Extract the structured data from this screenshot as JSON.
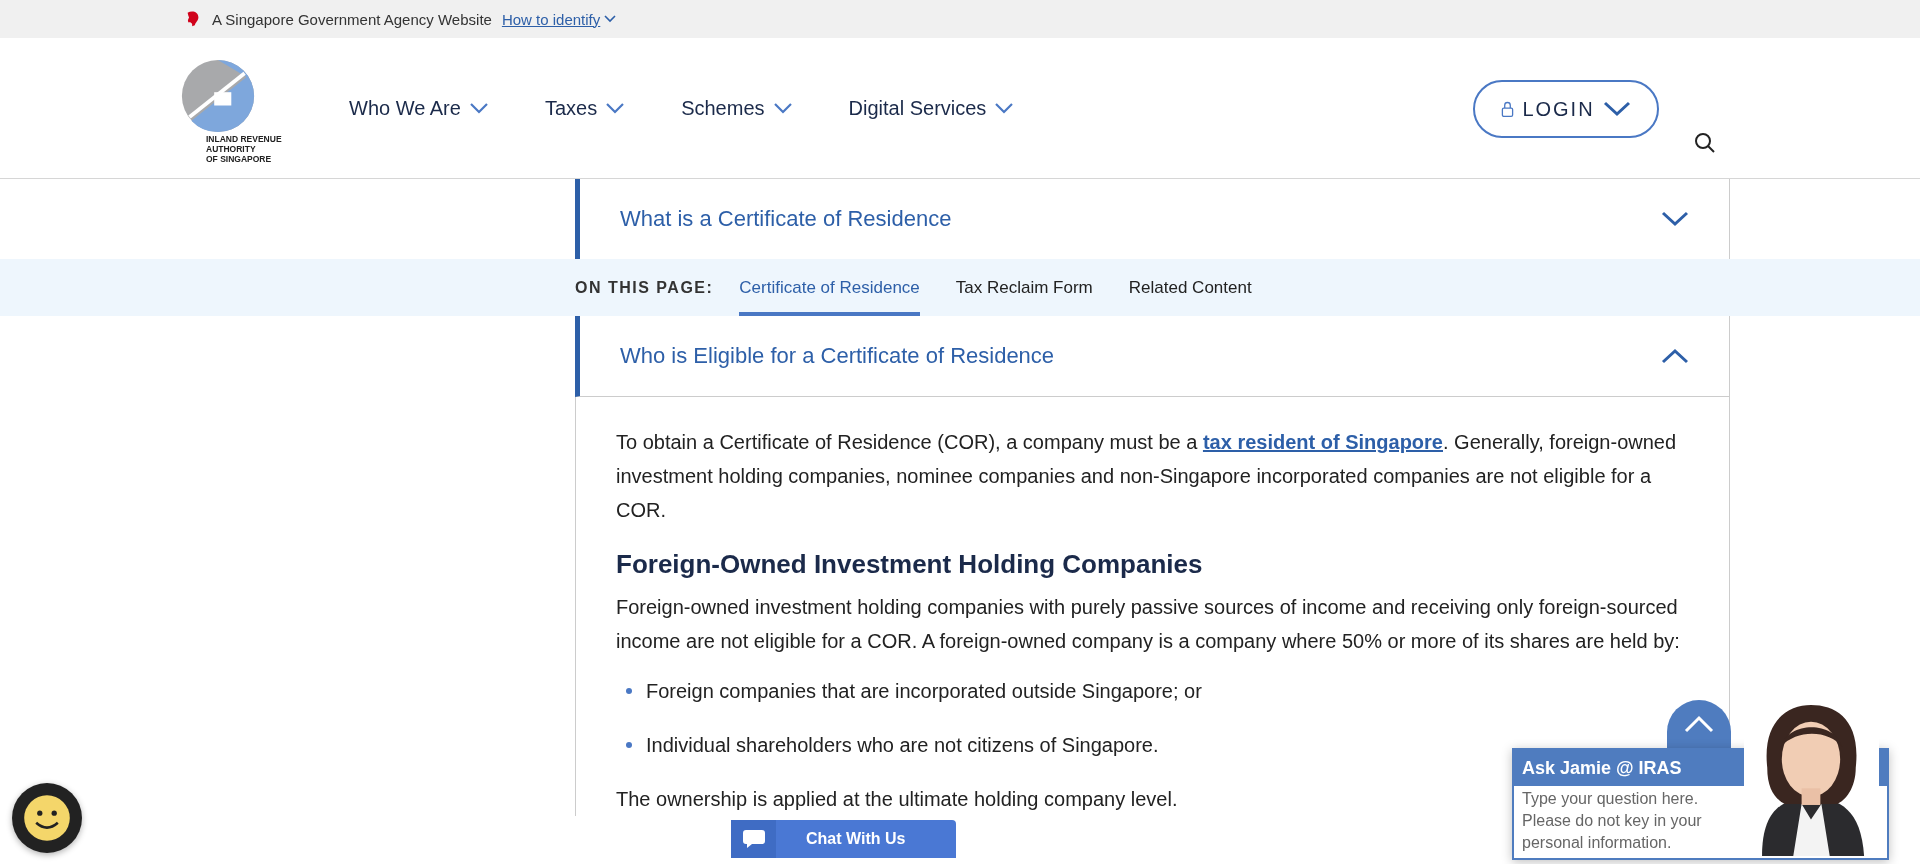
{
  "gov_banner": {
    "text": "A Singapore Government Agency Website",
    "link": "How to identify"
  },
  "logo": {
    "lines": [
      "INLAND REVENUE",
      "AUTHORITY",
      "OF SINGAPORE"
    ]
  },
  "nav": [
    {
      "label": "Who We Are"
    },
    {
      "label": "Taxes"
    },
    {
      "label": "Schemes"
    },
    {
      "label": "Digital Services"
    }
  ],
  "login": "LOGIN",
  "accordions": [
    {
      "title": "What is a Certificate of Residence",
      "expanded": false
    },
    {
      "title": "Who is Eligible for a Certificate of Residence",
      "expanded": true
    }
  ],
  "on_this_page": {
    "label": "ON THIS PAGE:",
    "links": [
      {
        "label": "Certificate of Residence",
        "selected": true
      },
      {
        "label": "Tax Reclaim Form",
        "selected": false
      },
      {
        "label": "Related Content",
        "selected": false
      }
    ]
  },
  "content": [
    {
      "kind": "paragraph",
      "parts": [
        {
          "kind": "text",
          "text": "To obtain a Certificate of Residence (COR), a company must be a "
        },
        {
          "kind": "link",
          "text": "tax resident of Singapore"
        },
        {
          "kind": "text",
          "text": ". Generally, foreign-owned investment holding companies, nominee companies and non-Singapore incorporated companies are not eligible for a COR."
        }
      ]
    },
    {
      "kind": "heading",
      "text": "Foreign-Owned Investment Holding Companies"
    },
    {
      "kind": "paragraph",
      "parts": [
        {
          "kind": "text",
          "text": "Foreign-owned investment holding companies with purely passive sources of income and receiving only foreign-sourced income are not eligible for a COR. A foreign-owned company is a company where 50% or more of its shares are held by:"
        }
      ]
    },
    {
      "kind": "bullet",
      "text": "Foreign companies that are incorporated outside Singapore; or"
    },
    {
      "kind": "bullet",
      "text": "Individual shareholders who are not citizens of Singapore."
    },
    {
      "kind": "paragraph",
      "parts": [
        {
          "kind": "text",
          "text": "The ownership is applied at the ultimate holding company level."
        }
      ]
    }
  ],
  "chat_button": "Chat With Us",
  "ask_jamie": {
    "title": "Ask Jamie @ IRAS",
    "placeholder": "Type your question here. Please do not key in your personal information."
  }
}
